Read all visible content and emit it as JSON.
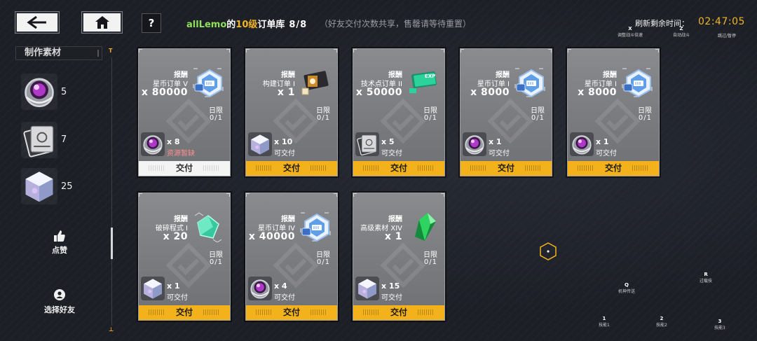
{
  "nav": {
    "help_label": "?"
  },
  "materials_panel": {
    "title": "制作素材",
    "items": [
      {
        "icon": "purple-orb-icon",
        "count": "5"
      },
      {
        "icon": "tech-drive-icon",
        "count": "7"
      },
      {
        "icon": "crystal-cube-icon",
        "count": "25"
      }
    ],
    "scroll_top": "T",
    "scroll_bottom": "⊥"
  },
  "side_actions": {
    "like_label": "点赞",
    "select_friend_label": "选择好友"
  },
  "header": {
    "player_name": "allLemo",
    "of_text": "的",
    "level": "10级",
    "title_suffix": "订单库",
    "count": "8/8",
    "note": "（好友交付次数共享，售罄请等待重置）"
  },
  "timer": {
    "label": "刷新剩余时间：",
    "value": "02:47:05"
  },
  "hotkeys": [
    {
      "key": "X",
      "label": "调整战斗倍速"
    },
    {
      "key": "Z",
      "label": "自动战斗"
    },
    {
      "key": "",
      "label": "跳过/暂停"
    },
    {
      "key": "Q",
      "label": "机神传送"
    },
    {
      "key": "R",
      "label": "过载技"
    },
    {
      "key": "1",
      "label": "技能1"
    },
    {
      "key": "2",
      "label": "技能2"
    },
    {
      "key": "3",
      "label": "技能3"
    }
  ],
  "reward_label": "报酬",
  "limit_label": "日限",
  "orders": [
    {
      "reward_name": "星币订单 V",
      "reward_qty": "x 80000",
      "reward_icon": "star-coin-ticket-icon",
      "limit": "0/1",
      "req_icon": "purple-orb-icon",
      "req_qty": "x 8",
      "status": "资源暂缺",
      "deliver_label": "交付",
      "can_deliver": false
    },
    {
      "reward_name": "构建订单 I",
      "reward_qty": "x 1",
      "reward_icon": "build-card-icon",
      "limit": "0/1",
      "req_icon": "crystal-cube-icon",
      "req_qty": "x 10",
      "status": "可交付",
      "deliver_label": "交付",
      "can_deliver": true
    },
    {
      "reward_name": "技术点订单 II",
      "reward_qty": "x 50000",
      "reward_icon": "exp-card-icon",
      "limit": "0/1",
      "req_icon": "tech-drive-icon",
      "req_qty": "x 5",
      "status": "可交付",
      "deliver_label": "交付",
      "can_deliver": true
    },
    {
      "reward_name": "星币订单 I",
      "reward_qty": "x 8000",
      "reward_icon": "star-coin-ticket-icon",
      "limit": "0/1",
      "req_icon": "purple-orb-icon",
      "req_qty": "x 1",
      "status": "可交付",
      "deliver_label": "交付",
      "can_deliver": true
    },
    {
      "reward_name": "星币订单 I",
      "reward_qty": "x 8000",
      "reward_icon": "star-coin-ticket-icon",
      "limit": "0/1",
      "req_icon": "purple-orb-icon",
      "req_qty": "x 1",
      "status": "可交付",
      "deliver_label": "交付",
      "can_deliver": true
    },
    {
      "reward_name": "破碎程式 I",
      "reward_qty": "x 20",
      "reward_icon": "green-shard-icon",
      "limit": "0/1",
      "req_icon": "crystal-cube-icon",
      "req_qty": "x 1",
      "status": "可交付",
      "deliver_label": "交付",
      "can_deliver": true
    },
    {
      "reward_name": "星币订单 IV",
      "reward_qty": "x 40000",
      "reward_icon": "star-coin-ticket-icon",
      "limit": "0/1",
      "req_icon": "purple-orb-icon",
      "req_qty": "x 4",
      "status": "可交付",
      "deliver_label": "交付",
      "can_deliver": true
    },
    {
      "reward_name": "高级素材 XIV",
      "reward_qty": "x 1",
      "reward_icon": "emerald-crystal-icon",
      "limit": "0/1",
      "req_icon": "crystal-cube-icon",
      "req_qty": "x 15",
      "status": "可交付",
      "deliver_label": "交付",
      "can_deliver": true
    }
  ],
  "colors": {
    "accent": "#f3b21c",
    "player_name": "#8ee05a",
    "level": "#f0b428",
    "shortage": "#ff8e8e"
  }
}
